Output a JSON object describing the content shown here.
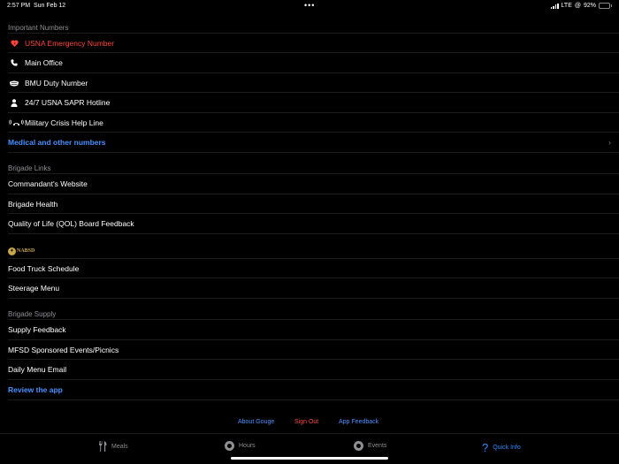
{
  "status": {
    "time": "2:57 PM",
    "date": "Sun Feb 12",
    "network": "LTE",
    "battery_text": "92%",
    "battery_level": 0.92
  },
  "sections": {
    "important": {
      "header": "Important Numbers",
      "items": [
        {
          "label": "USNA Emergency Number",
          "icon": "heart-bolt-icon"
        },
        {
          "label": "Main Office",
          "icon": "phone-icon"
        },
        {
          "label": "BMU Duty Number",
          "icon": "face-mask-icon"
        },
        {
          "label": "24/7 USNA SAPR Hotline",
          "icon": "person-icon"
        },
        {
          "label": "Military Crisis Help Line",
          "icon": "phone-ringing-icon"
        }
      ],
      "more_link": "Medical and other numbers"
    },
    "brigade_links": {
      "header": "Brigade Links",
      "items": [
        {
          "label": "Commandant's Website"
        },
        {
          "label": "Brigade Health"
        },
        {
          "label": "Quality of Life (QOL) Board Feedback"
        }
      ]
    },
    "nabsd": {
      "logo_text": "NABSD",
      "items": [
        {
          "label": "Food Truck Schedule"
        },
        {
          "label": "Steerage Menu"
        }
      ]
    },
    "brigade_supply": {
      "header": "Brigade Supply",
      "items": [
        {
          "label": "Supply Feedback"
        },
        {
          "label": "MFSD Sponsored Events/Picnics"
        },
        {
          "label": "Daily Menu Email"
        }
      ],
      "review_link": "Review the app"
    }
  },
  "footer": {
    "about": "About Gouge",
    "sign_out": "Sign Out",
    "feedback": "App Feedback"
  },
  "tabs": [
    {
      "label": "Meals",
      "icon": "fork-knife-icon"
    },
    {
      "label": "Hours",
      "icon": "clock-icon"
    },
    {
      "label": "Events",
      "icon": "clock-icon"
    },
    {
      "label": "Quick Info",
      "icon": "question-icon",
      "active": true
    }
  ],
  "colors": {
    "red": "#ff453a",
    "blue": "#4a90ff",
    "active_tab": "#2f8cff",
    "gray": "#8e8e93",
    "background": "#000000"
  }
}
